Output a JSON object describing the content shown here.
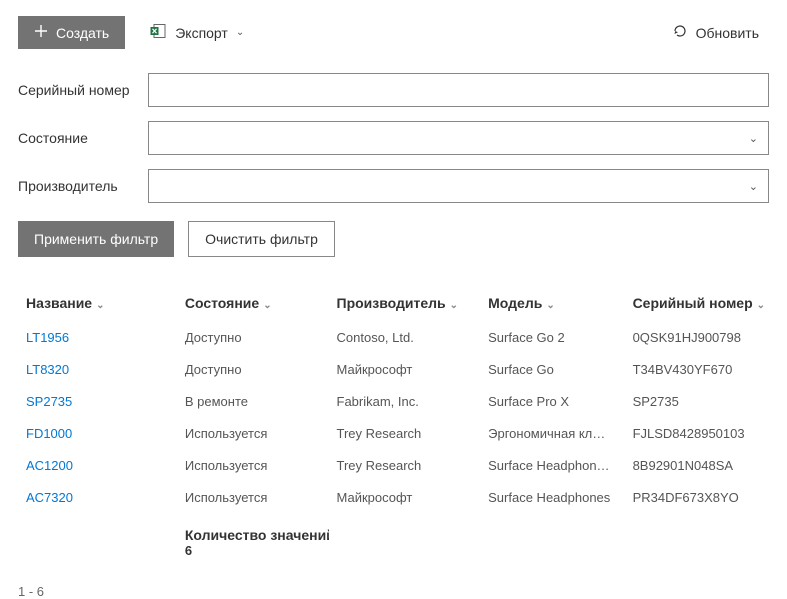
{
  "toolbar": {
    "create_label": "Создать",
    "export_label": "Экспорт",
    "refresh_label": "Обновить"
  },
  "filters": {
    "serial_label": "Серийный номер",
    "serial_value": "",
    "status_label": "Состояние",
    "status_value": "",
    "manufacturer_label": "Производитель",
    "manufacturer_value": ""
  },
  "actions": {
    "apply_label": "Применить фильтр",
    "clear_label": "Очистить фильтр"
  },
  "columns": {
    "name": "Название",
    "status": "Состояние",
    "manufacturer": "Производитель",
    "model": "Модель",
    "serial": "Серийный номер"
  },
  "rows": [
    {
      "name": "LT1956",
      "status": "Доступно",
      "manufacturer": "Contoso, Ltd.",
      "model": "Surface Go 2",
      "serial": "0QSK91HJ900798"
    },
    {
      "name": "LT8320",
      "status": "Доступно",
      "manufacturer": "Майкрософт",
      "model": "Surface Go",
      "serial": "T34BV430YF670"
    },
    {
      "name": "SP2735",
      "status": "В ремонте",
      "manufacturer": "Fabrikam, Inc.",
      "model": "Surface Pro X",
      "serial": "SP2735"
    },
    {
      "name": "FD1000",
      "status": "Используется",
      "manufacturer": "Trey Research",
      "model": "Эргономичная кл…",
      "serial": "FJLSD8428950103"
    },
    {
      "name": "AC1200",
      "status": "Используется",
      "manufacturer": "Trey Research",
      "model": "Surface Headphon…",
      "serial": "8B92901N048SA"
    },
    {
      "name": "AC7320",
      "status": "Используется",
      "manufacturer": "Майкрософт",
      "model": "Surface Headphones",
      "serial": "PR34DF673X8YO"
    }
  ],
  "footer": {
    "count_label": "Количество значений",
    "count_value": "6",
    "pager": "1 - 6"
  }
}
